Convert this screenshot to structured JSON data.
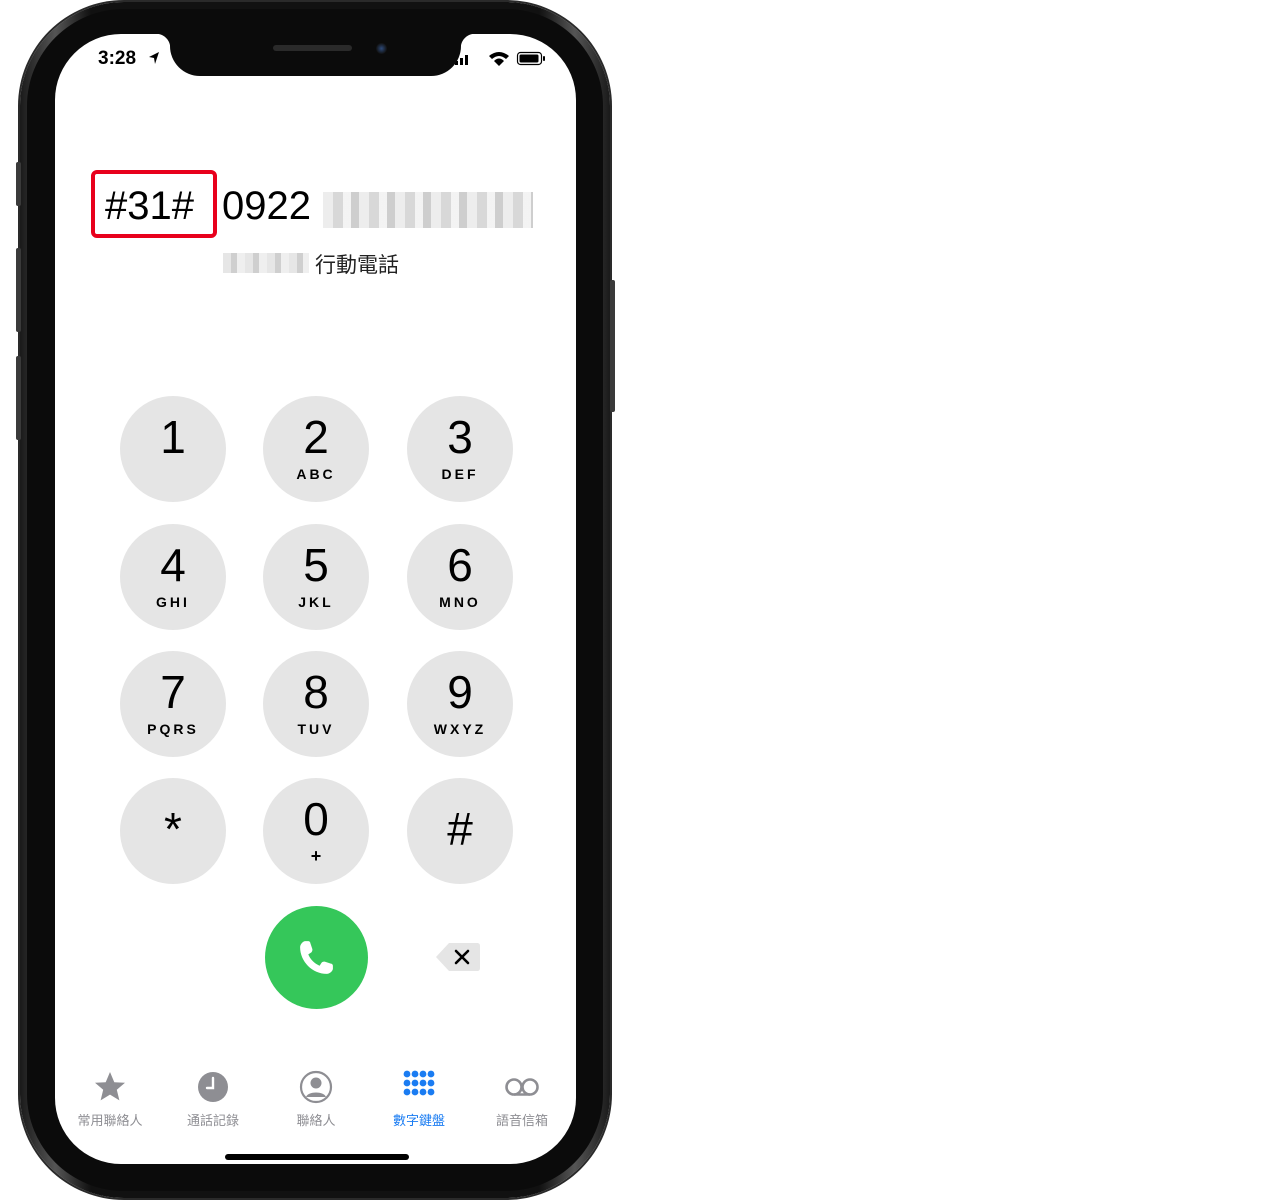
{
  "status": {
    "time": "3:28"
  },
  "dialer": {
    "prefix_code": "#31#",
    "number_visible": "0922",
    "contact_label": "行動電話"
  },
  "keypad": [
    {
      "digit": "1",
      "letters": ""
    },
    {
      "digit": "2",
      "letters": "ABC"
    },
    {
      "digit": "3",
      "letters": "DEF"
    },
    {
      "digit": "4",
      "letters": "GHI"
    },
    {
      "digit": "5",
      "letters": "JKL"
    },
    {
      "digit": "6",
      "letters": "MNO"
    },
    {
      "digit": "7",
      "letters": "PQRS"
    },
    {
      "digit": "8",
      "letters": "TUV"
    },
    {
      "digit": "9",
      "letters": "WXYZ"
    },
    {
      "digit": "*",
      "letters": ""
    },
    {
      "digit": "0",
      "letters": "+"
    },
    {
      "digit": "#",
      "letters": ""
    }
  ],
  "tabs": [
    {
      "label": "常用聯絡人",
      "icon": "star-icon"
    },
    {
      "label": "通話記錄",
      "icon": "clock-icon"
    },
    {
      "label": "聯絡人",
      "icon": "person-icon"
    },
    {
      "label": "數字鍵盤",
      "icon": "keypad-icon"
    },
    {
      "label": "語音信箱",
      "icon": "voicemail-icon"
    }
  ],
  "colors": {
    "call_green": "#35c75a",
    "active_tab": "#1a7cf2",
    "highlight_red": "#e8001c",
    "key_bg": "#e5e5e5"
  }
}
